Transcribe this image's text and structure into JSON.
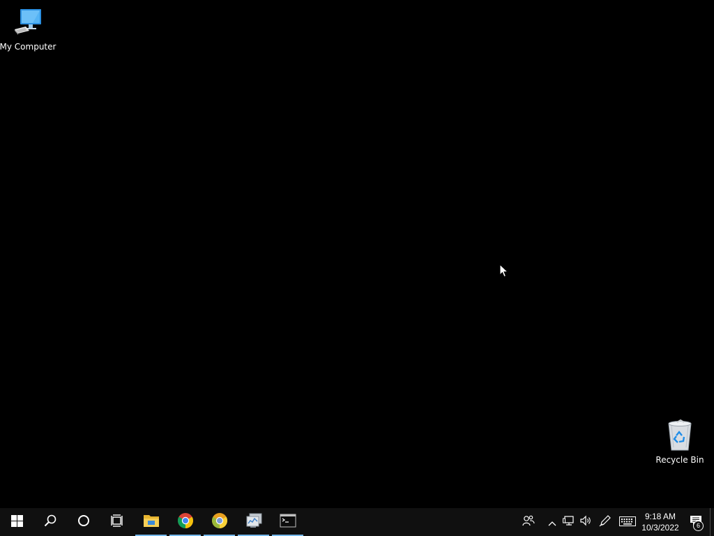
{
  "desktop": {
    "icons": [
      {
        "label": "My Computer",
        "icon": "computer-icon"
      },
      {
        "label": "Recycle Bin",
        "icon": "recycle-bin-icon"
      }
    ]
  },
  "taskbar": {
    "buttons": [
      {
        "icon": "windows-start-icon"
      },
      {
        "icon": "search-icon"
      },
      {
        "icon": "cortana-icon"
      },
      {
        "icon": "task-view-icon"
      }
    ],
    "apps": [
      {
        "icon": "file-explorer-icon"
      },
      {
        "icon": "chrome-icon"
      },
      {
        "icon": "chrome-canary-icon"
      },
      {
        "icon": "system-monitor-icon"
      },
      {
        "icon": "terminal-icon"
      }
    ],
    "tray": {
      "icons": [
        "people-icon",
        "chevron-up-icon",
        "network-icon",
        "volume-icon",
        "pen-workspace-icon",
        "keyboard-icon"
      ],
      "time": "9:18 AM",
      "date": "10/3/2022",
      "notification_count": "6"
    }
  },
  "colors": {
    "background": "#000000",
    "taskbar": "#101010",
    "active_indicator": "#76b9ed"
  }
}
